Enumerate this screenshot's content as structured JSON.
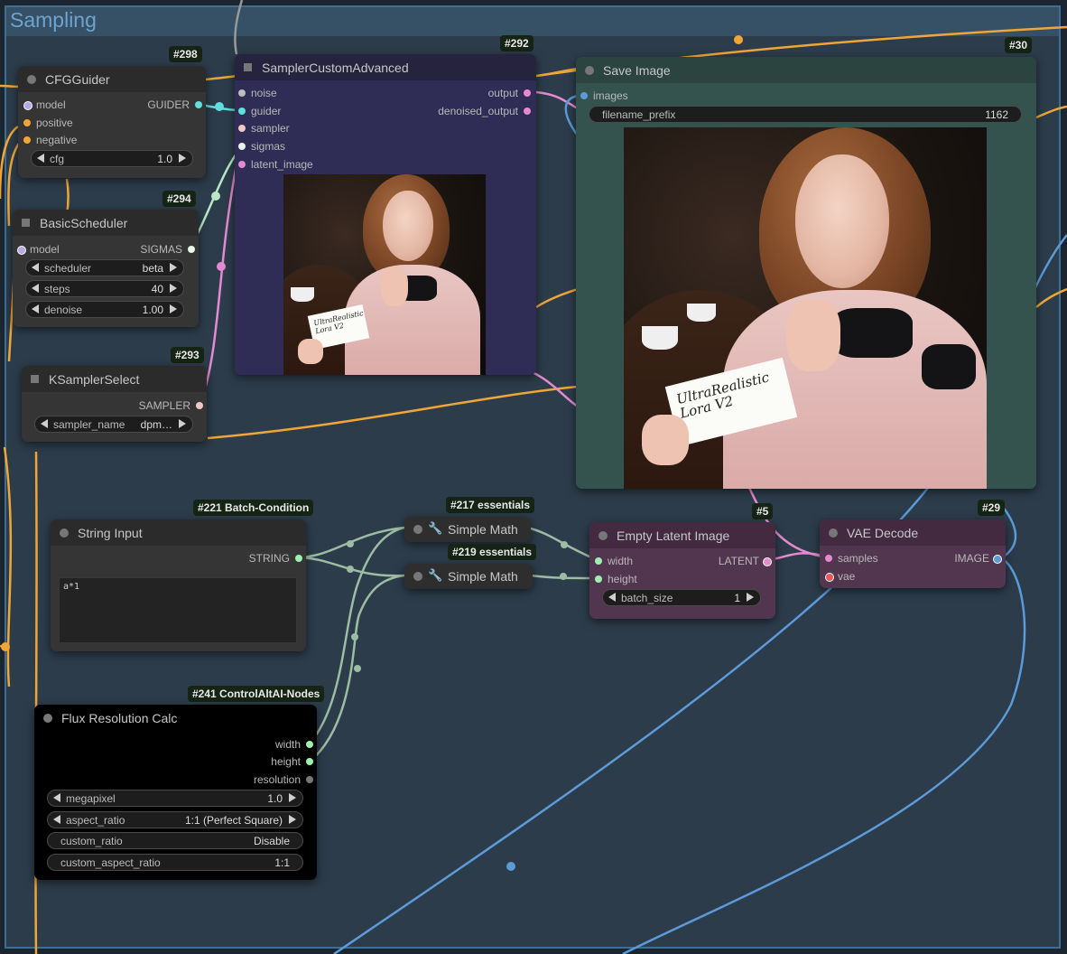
{
  "group": {
    "title": "Sampling"
  },
  "nodes": {
    "cfg_guider": {
      "id": "#298",
      "title": "CFGGuider",
      "inputs": [
        "model",
        "positive",
        "negative"
      ],
      "output": "GUIDER",
      "cfg": {
        "label": "cfg",
        "value": "1.0"
      }
    },
    "basic_scheduler": {
      "id": "#294",
      "title": "BasicScheduler",
      "input": "model",
      "output": "SIGMAS",
      "widgets": [
        {
          "label": "scheduler",
          "value": "beta"
        },
        {
          "label": "steps",
          "value": "40"
        },
        {
          "label": "denoise",
          "value": "1.00"
        }
      ]
    },
    "ksampler_select": {
      "id": "#293",
      "title": "KSamplerSelect",
      "output": "SAMPLER",
      "sampler_name": {
        "label": "sampler_name",
        "value": "dpm…"
      }
    },
    "sampler_custom_advanced": {
      "id": "#292",
      "title": "SamplerCustomAdvanced",
      "inputs": [
        "noise",
        "guider",
        "sampler",
        "sigmas",
        "latent_image"
      ],
      "outputs": [
        "output",
        "denoised_output"
      ],
      "card_text": "UltraRealistic\nLora V2"
    },
    "save_image": {
      "id": "#30",
      "title": "Save Image",
      "input": "images",
      "filename_prefix": {
        "label": "filename_prefix",
        "value": "1162"
      },
      "card_text": "UltraRealistic\nLora V2"
    },
    "string_input": {
      "id": "#221 Batch-Condition",
      "title": "String Input",
      "output": "STRING",
      "text": "a*1"
    },
    "simple_math_1": {
      "id": "#217 essentials",
      "title": "Simple Math"
    },
    "simple_math_2": {
      "id": "#219 essentials",
      "title": "Simple Math"
    },
    "empty_latent": {
      "id": "#5",
      "title": "Empty Latent Image",
      "inputs": [
        "width",
        "height"
      ],
      "output": "LATENT",
      "batch_size": {
        "label": "batch_size",
        "value": "1"
      }
    },
    "vae_decode": {
      "id": "#29",
      "title": "VAE Decode",
      "inputs": [
        "samples",
        "vae"
      ],
      "output": "IMAGE"
    },
    "flux_res": {
      "id": "#241 ControlAltAI-Nodes",
      "title": "Flux Resolution Calc",
      "outputs": [
        "width",
        "height",
        "resolution"
      ],
      "widgets": [
        {
          "label": "megapixel",
          "value": "1.0"
        },
        {
          "label": "aspect_ratio",
          "value": "1:1 (Perfect Square)"
        },
        {
          "label": "custom_ratio",
          "value": "Disable"
        },
        {
          "label": "custom_aspect_ratio",
          "value": "1:1"
        }
      ]
    }
  },
  "colors": {
    "wire_orange": "#f0a636",
    "wire_green": "#9cbca4",
    "wire_blue": "#5c9ad8",
    "wire_pink": "#e58ad0",
    "wire_gray": "#9a9a9a",
    "wire_cyan": "#5fe0e0"
  },
  "icons": [
    "wrench-icon",
    "arrow-left-icon",
    "arrow-right-icon"
  ]
}
